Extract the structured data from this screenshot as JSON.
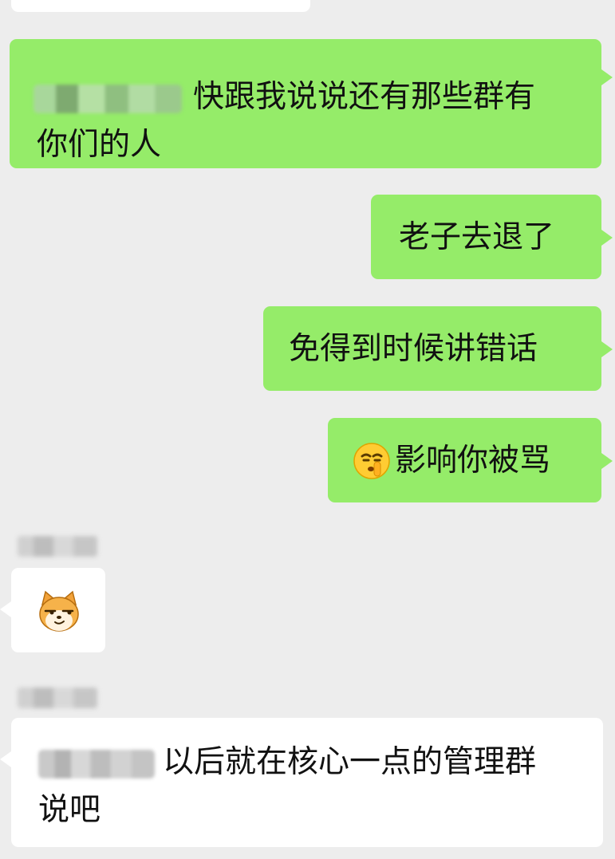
{
  "messages": [
    {
      "id": "m1",
      "direction": "sent",
      "line1": "快跟我说说还有那些群有",
      "line2": "你们的人"
    },
    {
      "id": "m2",
      "direction": "sent",
      "text": "老子去退了"
    },
    {
      "id": "m3",
      "direction": "sent",
      "text": "免得到时候讲错话"
    },
    {
      "id": "m4",
      "direction": "sent",
      "emoji": "shushing-face-emoji",
      "text": "影响你被骂"
    },
    {
      "id": "m5",
      "direction": "received",
      "emoji": "shiba-dog-sticker"
    },
    {
      "id": "m6",
      "direction": "received",
      "line1": "以后就在核心一点的管理群",
      "line2": "说吧"
    }
  ],
  "colors": {
    "background": "#ededed",
    "sent_bubble": "#95ec69",
    "received_bubble": "#ffffff",
    "text": "#111111"
  }
}
